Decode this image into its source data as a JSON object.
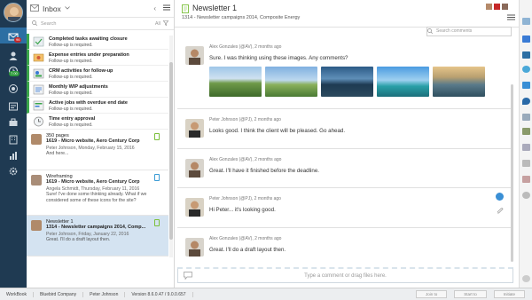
{
  "rail": {
    "badge_inbox": "96",
    "badge_time": "7.00"
  },
  "inbox": {
    "title": "Inbox",
    "search_placeholder": "Search",
    "filter_label": "All",
    "tasks": [
      {
        "title": "Completed tasks awaiting closure",
        "sub": "Follow-up is required."
      },
      {
        "title": "Expense entries under preparation",
        "sub": "Follow-up is required."
      },
      {
        "title": "CRM activities for follow-up",
        "sub": "Follow-up is required."
      },
      {
        "title": "Monthly WIP adjustments",
        "sub": "Follow-up is required."
      },
      {
        "title": "Active jobs with overdue end date",
        "sub": "Follow-up is required."
      },
      {
        "title": "Time entry approval",
        "sub": "Follow-up is required."
      }
    ],
    "messages": [
      {
        "l1": "350 pages",
        "l2": "1619 - Micro website, Aero Century Corp",
        "l3": "Peter Johnson, Monday, February 15, 2016",
        "l4": "And here..."
      },
      {
        "l1": "Wireframing",
        "l2": "1619 - Micro website, Aero Century Corp",
        "l3": "Angela Schmidt, Thursday, February 11, 2016",
        "l4": "Sure! I've done some thinking already. What if we considered some of these icons for the site?"
      },
      {
        "l1": "Newsletter 1",
        "l2": "1314 - Newsletter campaigns 2014, Comp...",
        "l3": "Peter Johnson, Friday, January 22, 2016",
        "l4": "Great. I'll do a draft layout then."
      }
    ]
  },
  "main": {
    "title": "Newsletter 1",
    "subtitle": "1314 - Newsletter campaigns 2014, Composite Energy",
    "comment_search_placeholder": "Search comments",
    "posts": [
      {
        "who": "Alex Gonzales (@AV), 2 months ago",
        "text": "Sure. I was thinking using these images. Any comments?"
      },
      {
        "who": "Peter Johnson (@PJ), 2 months ago",
        "text": "Looks good. I think the client will be pleased. Go ahead."
      },
      {
        "who": "Alex Gonzales (@AV), 2 months ago",
        "text": "Great. I'll have it finished before the deadline."
      },
      {
        "who": "Peter Johnson (@PJ), 2 months ago",
        "text": "Hi Peter... it's looking good."
      },
      {
        "who": "Alex Gonzales (@AV), 2 months ago",
        "text": "Great. I'll do a draft layout then."
      }
    ],
    "composer_placeholder": "Type a comment or drag files here."
  },
  "status": {
    "app": "WorkBook",
    "company": "Bluebird Company",
    "user": "Peter Johnson",
    "version": "Version 8.6.0.47 / 9.0.0.657",
    "btn1": "Join to",
    "btn2": "Start to",
    "btn3": "Initiate"
  },
  "colors": {
    "rail": "#1f3a52",
    "accent": "#2d6fa3",
    "selected": "#d4e3f1",
    "followup": "#3aa54a"
  }
}
